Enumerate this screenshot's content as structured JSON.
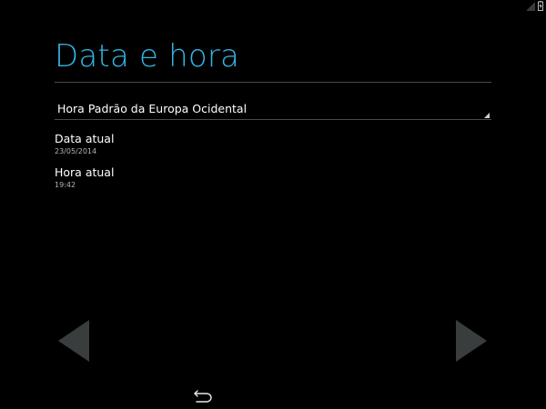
{
  "screen": {
    "title": "Data e hora"
  },
  "timezone": {
    "selected": "Hora Padrão da Europa Ocidental"
  },
  "settings": {
    "date": {
      "title": "Data atual",
      "value": "23/05/2014"
    },
    "time": {
      "title": "Hora atual",
      "value": "19:42"
    }
  },
  "navigation": {
    "prev_icon": "left-triangle-icon",
    "next_icon": "right-triangle-icon",
    "back_icon": "back-arrow-icon"
  },
  "status_bar": {
    "icons": [
      "signal-icon",
      "battery-charging-icon"
    ]
  },
  "colors": {
    "accent": "#33b5e5",
    "background": "#000000",
    "divider": "#4a4a4a",
    "nav_arrow": "#3a3d3d"
  }
}
